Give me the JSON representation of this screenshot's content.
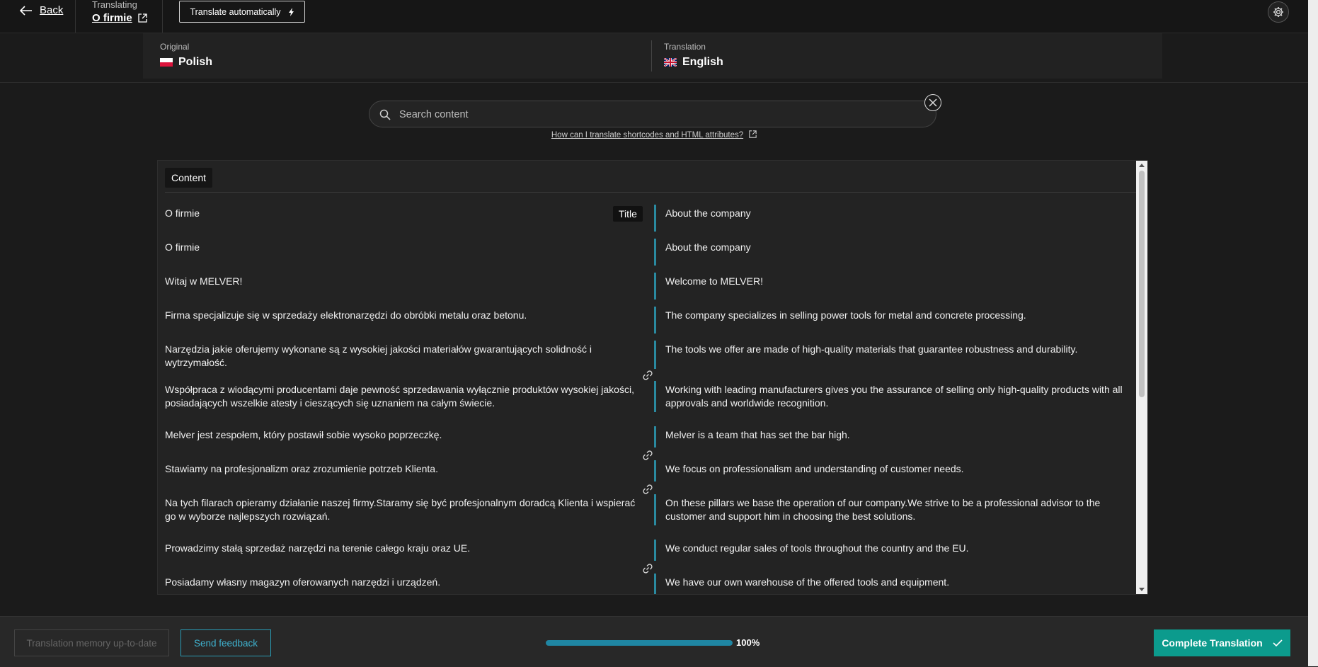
{
  "header": {
    "back_label": "Back",
    "translating_label": "Translating",
    "page_title": "O firmie",
    "auto_translate_label": "Translate automatically"
  },
  "languages": {
    "original_label": "Original",
    "original_name": "Polish",
    "translation_label": "Translation",
    "translation_name": "English"
  },
  "search": {
    "placeholder": "Search content",
    "help_link": "How can I translate shortcodes and HTML attributes?"
  },
  "content": {
    "section_label": "Content",
    "title_tag": "Title",
    "rows": [
      {
        "original": "O firmie",
        "translation": "About the company"
      },
      {
        "original": "O firmie",
        "translation": "About the company"
      },
      {
        "original": "Witaj w MELVER!",
        "translation": "Welcome to MELVER!"
      },
      {
        "original": "Firma specjalizuje się w sprzedaży elektronarzędzi do obróbki metalu oraz betonu.",
        "translation": "The company specializes in selling power tools for metal and concrete processing."
      },
      {
        "original": "Narzędzia jakie oferujemy wykonane są z wysokiej jakości materiałów gwarantujących solidność i wytrzymałość.",
        "translation": "The tools we offer are made of high-quality materials that guarantee robustness and durability."
      },
      {
        "original": "Współpraca z wiodącymi producentami daje pewność sprzedawania wyłącznie produktów wysokiej jakości, posiadających wszelkie atesty i cieszących się uznaniem na całym świecie.",
        "translation": "Working with leading manufacturers gives you the assurance of selling only high-quality products with all approvals and worldwide recognition."
      },
      {
        "original": "Melver jest zespołem, który postawił sobie wysoko poprzeczkę.",
        "translation": "Melver is a team that has set the bar high."
      },
      {
        "original": "Stawiamy na profesjonalizm oraz zrozumienie potrzeb Klienta.",
        "translation": "We focus on professionalism and understanding of customer needs."
      },
      {
        "original": "Na tych filarach opieramy działanie naszej firmy.Staramy się być profesjonalnym doradcą Klienta i wspierać go w wyborze najlepszych rozwiązań.",
        "translation": "On these pillars we base the operation of our company.We strive to be a professional advisor to the customer and support him in choosing the best solutions."
      },
      {
        "original": "Prowadzimy stałą sprzedaż narzędzi na terenie całego kraju oraz UE.",
        "translation": "We conduct regular sales of tools throughout the country and the EU."
      },
      {
        "original": "Posiadamy własny magazyn oferowanych narzędzi i urządzeń.",
        "translation": "We have our own warehouse of the offered tools and equipment."
      }
    ]
  },
  "footer": {
    "memory_label": "Translation memory up-to-date",
    "feedback_label": "Send feedback",
    "progress_percent": 100,
    "progress_text": "100%",
    "complete_label": "Complete Translation"
  },
  "colors": {
    "accent": "#1f86a3",
    "complete": "#0c9b8d",
    "background": "#1b1b1b"
  }
}
